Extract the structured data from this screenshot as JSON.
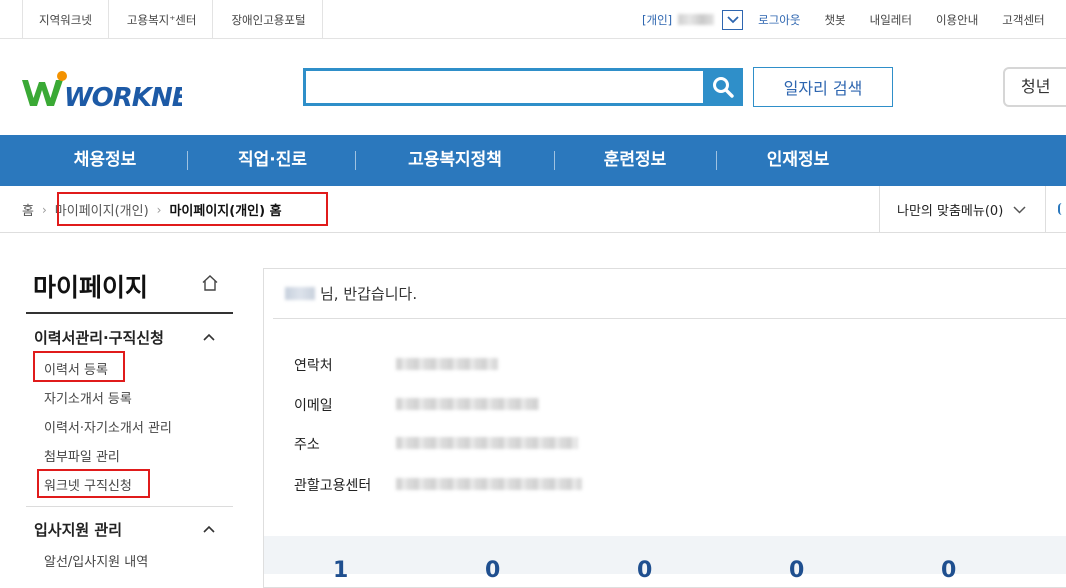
{
  "utility_bar": {
    "left_links": [
      "지역워크넷",
      "고용복지⁺센터",
      "장애인고용포털"
    ],
    "user_type": "[개인]",
    "right_links": [
      "로그아웃",
      "챗봇",
      "내일레터",
      "이용안내",
      "고객센터"
    ]
  },
  "header": {
    "logo_text": "WORKNET",
    "search": {
      "value": "",
      "placeholder": ""
    },
    "job_search_label": "일자리 검색",
    "youth_label": "청년"
  },
  "gnb": {
    "items": [
      "채용정보",
      "직업·진로",
      "고용복지정책",
      "훈련정보",
      "인재정보"
    ]
  },
  "breadcrumb": {
    "home": "홈",
    "mid": "마이페이지(개인)",
    "current": "마이페이지(개인) 홈"
  },
  "my_menu": {
    "label": "나만의 맞춤메뉴(0)"
  },
  "sidebar": {
    "title": "마이페이지",
    "groups": [
      {
        "label": "이력서관리·구직신청",
        "items": [
          "이력서 등록",
          "자기소개서 등록",
          "이력서·자기소개서 관리",
          "첨부파일 관리",
          "워크넷 구직신청"
        ]
      },
      {
        "label": "입사지원 관리",
        "items": [
          "알선/입사지원 내역"
        ]
      }
    ]
  },
  "main": {
    "greeting_suffix": "님, 반갑습니다.",
    "info_labels": [
      "연락처",
      "이메일",
      "주소",
      "관할고용센터"
    ],
    "stats": [
      "1",
      "0",
      "0",
      "0",
      "0"
    ]
  },
  "colors": {
    "brand_blue": "#2b78bd",
    "search_blue": "#2f8fc9",
    "logo_green": "#3aa935",
    "logo_orange": "#f39200",
    "highlight_red": "#e01b1b"
  }
}
